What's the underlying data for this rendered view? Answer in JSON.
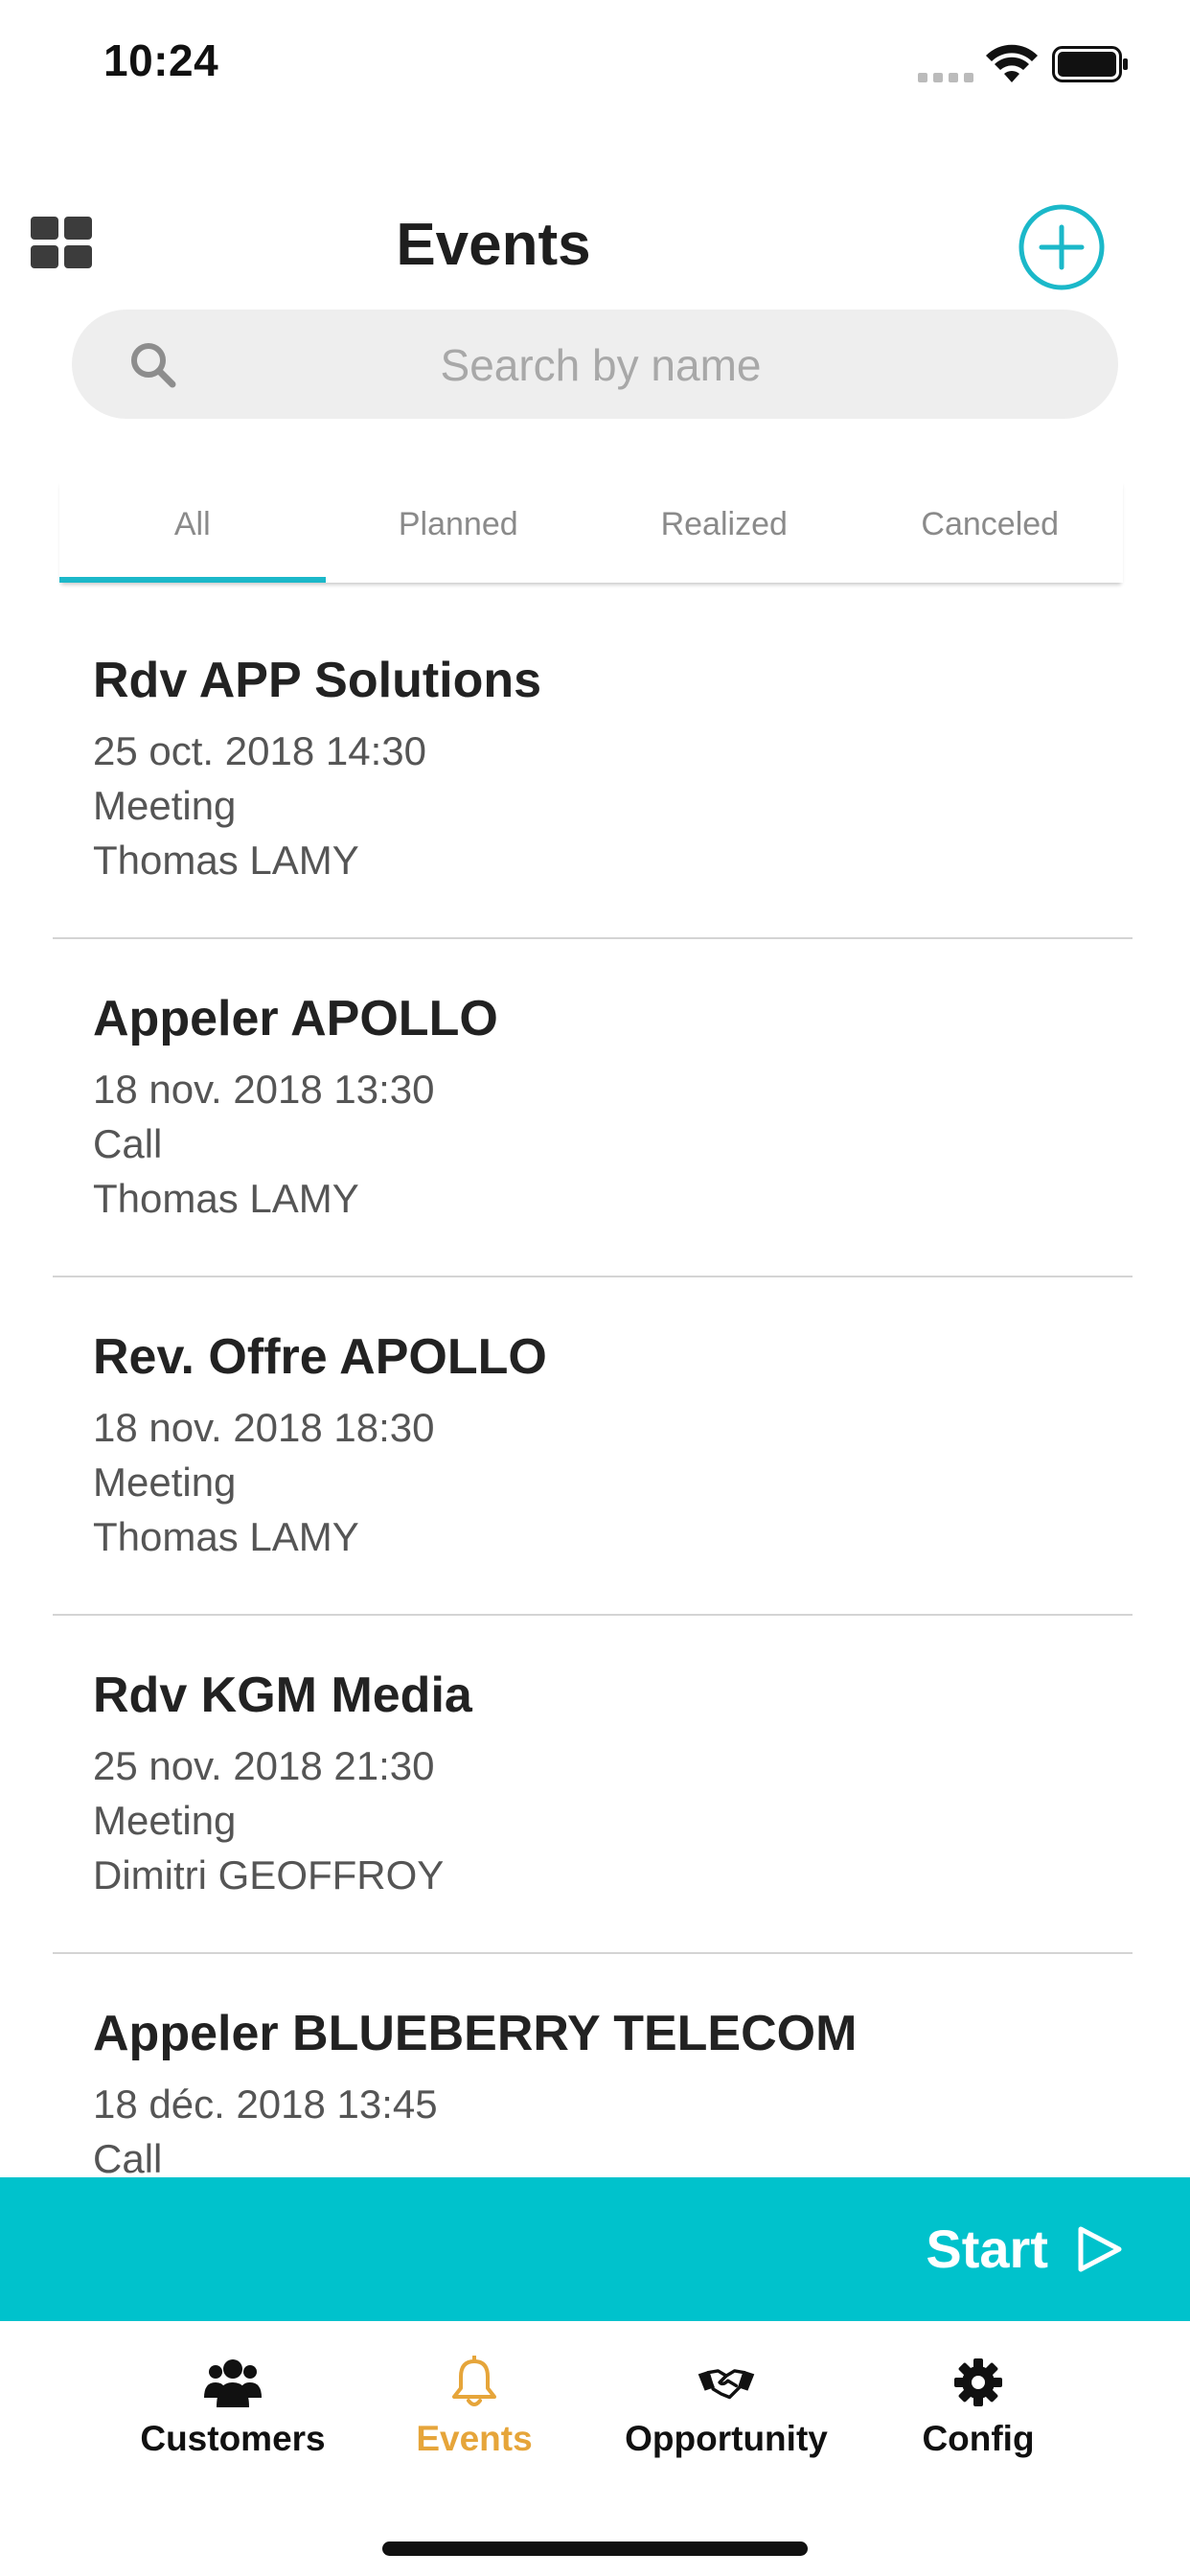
{
  "status_bar": {
    "time": "10:24"
  },
  "header": {
    "title": "Events",
    "left_icon": "grid-icon",
    "right_icon": "add-circle-icon"
  },
  "search": {
    "placeholder": "Search by name",
    "value": "",
    "icon": "search-icon"
  },
  "tabs": [
    {
      "label": "All",
      "active": true
    },
    {
      "label": "Planned",
      "active": false
    },
    {
      "label": "Realized",
      "active": false
    },
    {
      "label": "Canceled",
      "active": false
    }
  ],
  "events": [
    {
      "title": "Rdv APP Solutions",
      "datetime": "25 oct. 2018 14:30",
      "type": "Meeting",
      "person": "Thomas LAMY"
    },
    {
      "title": "Appeler APOLLO",
      "datetime": "18 nov. 2018 13:30",
      "type": "Call",
      "person": "Thomas LAMY"
    },
    {
      "title": "Rev. Offre APOLLO",
      "datetime": "18 nov. 2018 18:30",
      "type": "Meeting",
      "person": "Thomas LAMY"
    },
    {
      "title": "Rdv KGM Media",
      "datetime": "25 nov. 2018 21:30",
      "type": "Meeting",
      "person": "Dimitri GEOFFROY"
    },
    {
      "title": "Appeler BLUEBERRY TELECOM",
      "datetime": "18 déc. 2018 13:45",
      "type": "Call",
      "person": ""
    }
  ],
  "start_bar": {
    "label": "Start",
    "icon": "play-icon"
  },
  "bottom_nav": [
    {
      "label": "Customers",
      "icon": "users-icon",
      "active": false
    },
    {
      "label": "Events",
      "icon": "bell-icon",
      "active": true
    },
    {
      "label": "Opportunity",
      "icon": "handshake-icon",
      "active": false
    },
    {
      "label": "Config",
      "icon": "gear-icon",
      "active": false
    }
  ],
  "colors": {
    "accent": "#1bb8c9",
    "start_bar": "#00c2cc",
    "nav_active": "#e6a53a",
    "search_bg": "#eeeeee"
  }
}
